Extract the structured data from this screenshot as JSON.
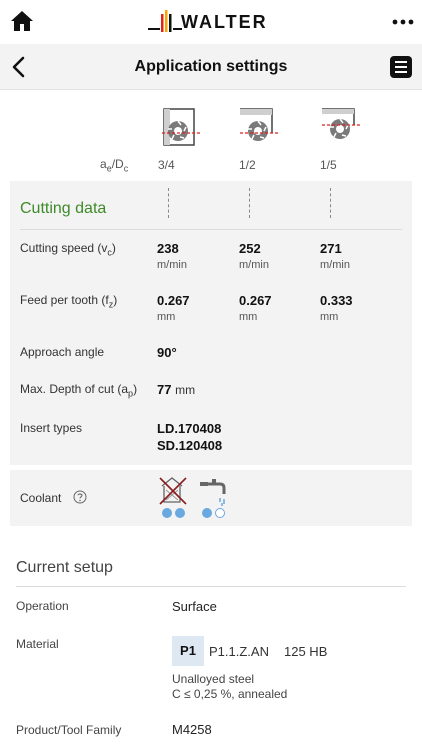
{
  "header": {
    "brand": "WALTER",
    "title": "Application settings",
    "icons": [
      "home-icon",
      "more-icon",
      "back-icon",
      "document-icon"
    ]
  },
  "tools": {
    "ae_dc_label": "a",
    "ae_sub": "e",
    "dc_text": "/D",
    "dc_sub": "c",
    "ratios": [
      "3/4",
      "1/2",
      "1/5"
    ]
  },
  "cutting": {
    "title": "Cutting data",
    "speed_label": "Cutting speed (v",
    "speed_sub": "c",
    "speed_values": [
      "238",
      "252",
      "271"
    ],
    "speed_unit": "m/min",
    "feed_label": "Feed per tooth (f",
    "feed_sub": "z",
    "feed_values": [
      "0.267",
      "0.267",
      "0.333"
    ],
    "feed_unit": "mm",
    "approach_label": "Approach angle",
    "approach_value": "90°",
    "depth_label": "Max. Depth of cut (a",
    "depth_sub": "p",
    "depth_value": "77",
    "depth_unit": "mm",
    "insert_label": "Insert types",
    "inserts": [
      "LD.170408",
      "SD.120408"
    ]
  },
  "coolant": {
    "label": "Coolant",
    "icons": [
      "dry-not-recommended-icon",
      "coolant-tap-icon"
    ],
    "colors": {
      "dot": "#6aa8e0",
      "cross": "#8a1c1c"
    }
  },
  "setup": {
    "title": "Current setup",
    "operation_label": "Operation",
    "operation_value": "Surface",
    "material_label": "Material",
    "material_group": "P1",
    "material_code": "P1.1.Z.AN",
    "material_hardness": "125 HB",
    "material_desc_1": "Unalloyed steel",
    "material_desc_2": "C ≤ 0,25 %, annealed",
    "family_label": "Product/Tool Family",
    "family_value": "M4258"
  },
  "colors": {
    "accent_green": "#3e8a2a",
    "panel": "#f3f3f3",
    "badge": "#dde8f3",
    "cut_line": "#d22"
  }
}
